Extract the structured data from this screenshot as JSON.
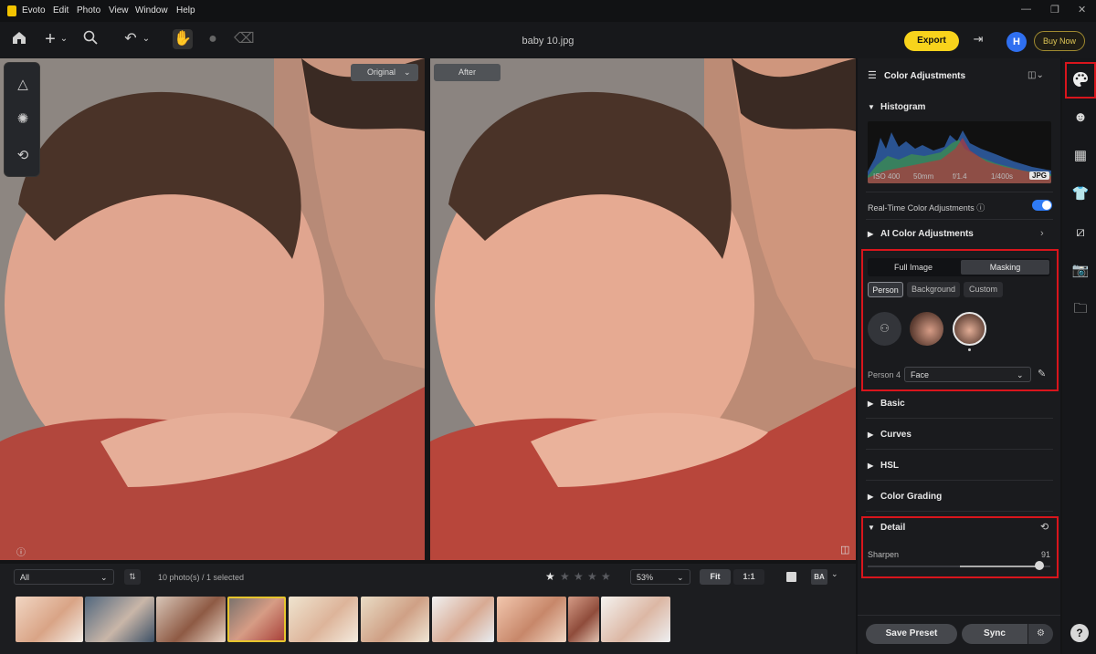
{
  "menu": {
    "app": "Evoto",
    "items": [
      "Edit",
      "Photo",
      "View",
      "Window",
      "Help"
    ]
  },
  "toolbar": {
    "filename": "baby 10.jpg",
    "export": "Export",
    "avatar": "H",
    "buy": "Buy Now"
  },
  "compare": {
    "original": "Original",
    "after": "After"
  },
  "filmstrip": {
    "filter": "All",
    "count": "10 photo(s) / 1 selected",
    "zoom": "53%",
    "fit": "Fit",
    "one_to_one": "1:1",
    "thumb_count": 10
  },
  "panel": {
    "title": "Color Adjustments",
    "histogram": {
      "label": "Histogram",
      "iso": "ISO 400",
      "focal": "50mm",
      "aperture": "f/1.4",
      "shutter": "1/400s",
      "format": "JPG"
    },
    "realtime": {
      "label": "Real-Time Color Adjustments",
      "enabled": true
    },
    "ai": "AI Color Adjustments",
    "masking": {
      "full": "Full Image",
      "mask": "Masking",
      "chips": [
        "Person",
        "Background",
        "Custom"
      ],
      "selected_chip": "Person",
      "person_label": "Person 4",
      "region": "Face"
    },
    "sections": {
      "basic": "Basic",
      "curves": "Curves",
      "hsl": "HSL",
      "grading": "Color Grading",
      "detail": "Detail"
    },
    "detail": {
      "sharpen_label": "Sharpen",
      "sharpen_value": "91",
      "sharpen_fraction": 0.91
    },
    "save_preset": "Save Preset",
    "sync": "Sync"
  },
  "colors": {
    "accent_yellow": "#f8d31c",
    "toggle_blue": "#2f7bf5",
    "highlight_red": "#d9151c"
  }
}
